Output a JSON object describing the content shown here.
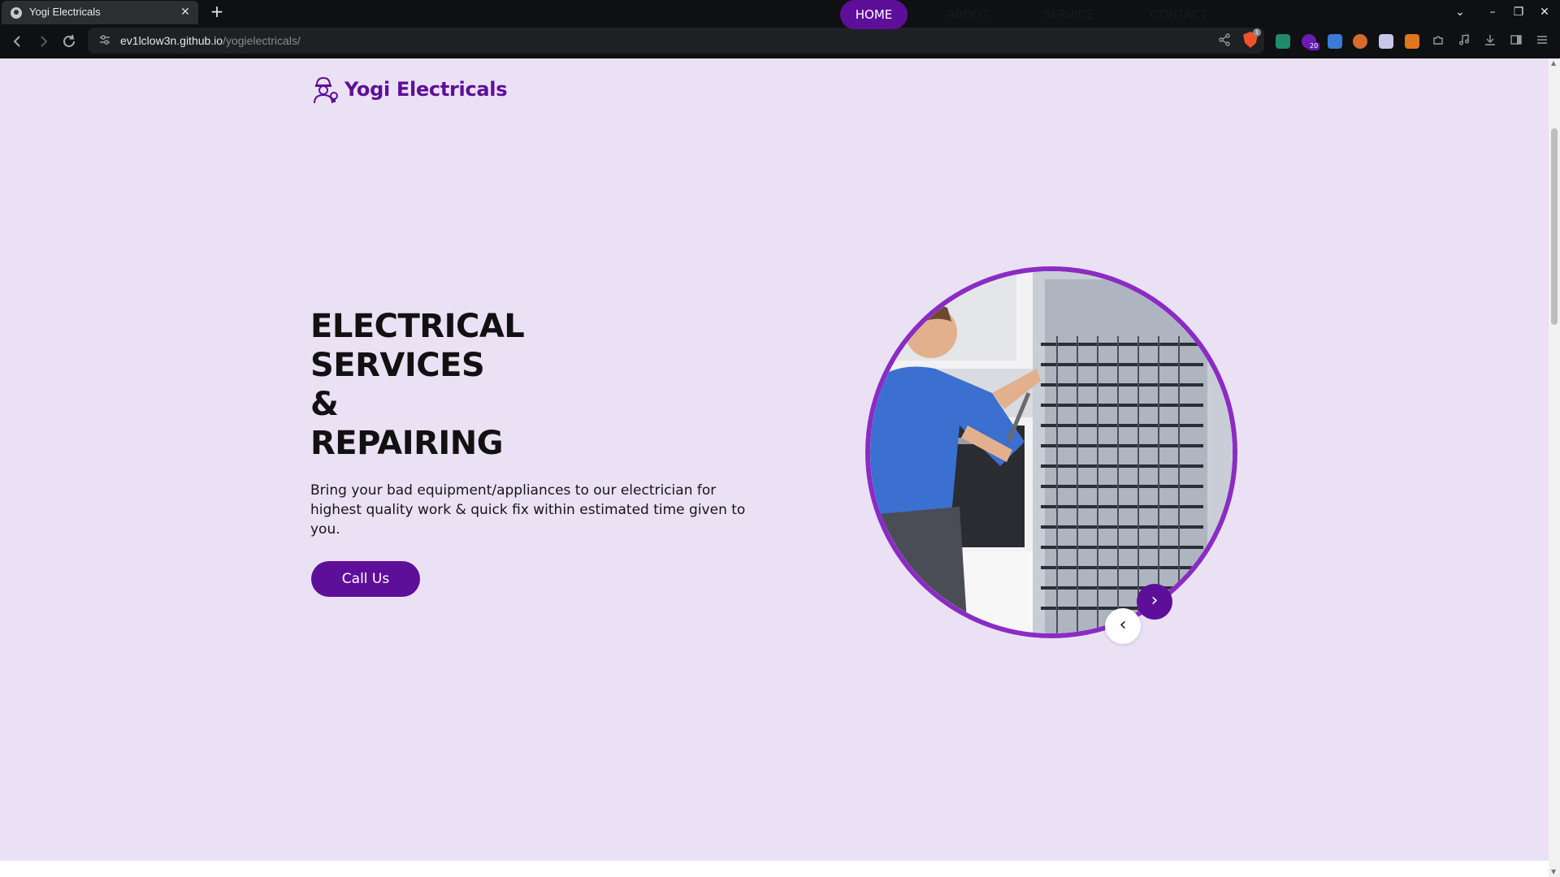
{
  "browser": {
    "tab_title": "Yogi Electricals",
    "tab_close": "✕",
    "new_tab": "+",
    "url_host": "ev1lclow3n.github.io",
    "url_path": "/yogielectricals/",
    "shield_count": "1",
    "extension_badge": "20",
    "window_controls": {
      "dropdown": "⌄",
      "minimize": "–",
      "restore": "❐",
      "close": "✕"
    }
  },
  "nav": {
    "logo_text": "Yogi Electricals",
    "items": [
      {
        "label": "HOME",
        "active": true
      },
      {
        "label": "ABOUT",
        "active": false
      },
      {
        "label": "SERVICE",
        "active": false
      },
      {
        "label": "CONTACT",
        "active": false
      }
    ]
  },
  "hero": {
    "title_lines": [
      "ELECTRICAL",
      "SERVICES",
      "&",
      "REPAIRING"
    ],
    "description": "Bring your bad equipment/appliances to our electrician for highest quality work & quick fix within estimated time given to you.",
    "cta_label": "Call Us",
    "image_subject": "technician repairing refrigerator coils",
    "next_arrow": "›",
    "prev_arrow": "‹"
  },
  "colors": {
    "brand": "#5e0f99",
    "ring": "#8a2cc4",
    "page_bg": "#eae1f4"
  }
}
